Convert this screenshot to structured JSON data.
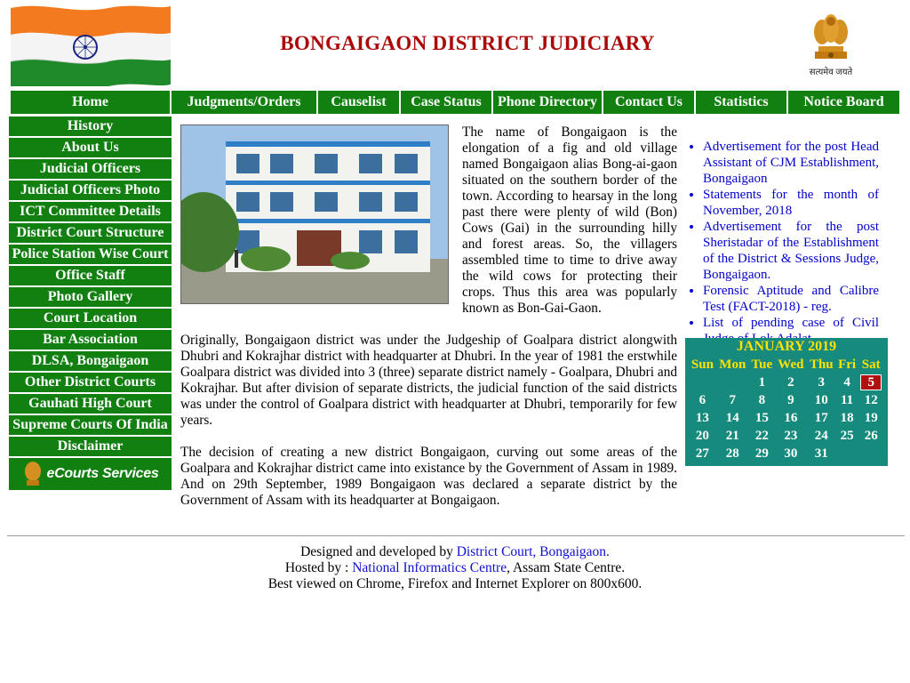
{
  "header": {
    "title": "BONGAIGAON DISTRICT JUDICIARY",
    "emblem_caption": "सत्यमेव जयते",
    "colors": {
      "title": "#aa0a0a",
      "nav": "#118011"
    }
  },
  "topnav": [
    {
      "label": "Home"
    },
    {
      "label": "Judgments/Orders"
    },
    {
      "label": "Causelist"
    },
    {
      "label": "Case Status"
    },
    {
      "label": "Phone Directory"
    },
    {
      "label": "Contact Us"
    },
    {
      "label": "Statistics"
    },
    {
      "label": "Notice Board"
    }
  ],
  "sidebar": [
    {
      "label": "History"
    },
    {
      "label": "About Us"
    },
    {
      "label": "Judicial Officers"
    },
    {
      "label": "Judicial Officers Photo"
    },
    {
      "label": "ICT Committee Details"
    },
    {
      "label": "District Court Structure"
    },
    {
      "label": "Police Station Wise Court"
    },
    {
      "label": "Office Staff"
    },
    {
      "label": "Photo Gallery"
    },
    {
      "label": "Court Location"
    },
    {
      "label": "Bar Association"
    },
    {
      "label": "DLSA, Bongaigaon"
    },
    {
      "label": "Other District Courts"
    },
    {
      "label": "Gauhati High Court"
    },
    {
      "label": "Supreme Courts Of India"
    },
    {
      "label": "Disclaimer"
    }
  ],
  "ecourts_label": "eCourts Services",
  "main": {
    "paragraphs": [
      "The name of Bongaigaon is the elongation of a fig and old village named Bongaigaon alias Bong-ai-gaon situated on the southern border of the town. According to hearsay in the long past there were plenty of wild (Bon) Cows (Gai) in the surrounding hilly and forest areas. So, the villagers assembled time to time to drive away the wild cows for protecting their crops. Thus this area was popularly known as Bon-Gai-Gaon.",
      "Originally, Bongaigaon district was under the Judgeship of Goalpara district alongwith Dhubri and Kokrajhar district with headquarter at Dhubri. In the year of 1981 the erstwhile Goalpara district was divided into 3 (three) separate district namely - Goalpara, Dhubri and Kokrajhar. But after division of separate districts, the judicial function of the said districts was under the control of Goalpara district with headquarter at Dhubri, temporarily for few years.",
      "The decision of creating a new district Bongaigaon, curving out some areas of the Goalpara and Kokrajhar district came into existance by the Government of Assam in 1989. And on 29th September, 1989 Bongaigaon was declared a separate district by the Government of Assam with its headquarter at Bongaigaon."
    ]
  },
  "notices": [
    "Advertisement for the post Head Assistant of CJM Establishment, Bongaigaon",
    "Statements for the month of November, 2018",
    "Advertisement for the post Sheristadar of the Establishment of the District & Sessions Judge, Bongaigaon.",
    "Forensic Aptitude and Calibre Test (FACT-2018) - reg.",
    "List of pending case of Civil Judge of Lok Adalat"
  ],
  "calendar": {
    "title": "JANUARY 2019",
    "weekdays": [
      "Sun",
      "Mon",
      "Tue",
      "Wed",
      "Thu",
      "Fri",
      "Sat"
    ],
    "weeks": [
      [
        "",
        "",
        "1",
        "2",
        "3",
        "4",
        "5"
      ],
      [
        "6",
        "7",
        "8",
        "9",
        "10",
        "11",
        "12"
      ],
      [
        "13",
        "14",
        "15",
        "16",
        "17",
        "18",
        "19"
      ],
      [
        "20",
        "21",
        "22",
        "23",
        "24",
        "25",
        "26"
      ],
      [
        "27",
        "28",
        "29",
        "30",
        "31",
        "",
        ""
      ]
    ],
    "today": "5"
  },
  "footer": {
    "designed_prefix": "Designed and developed by ",
    "designed_link": "District Court, Bongaigaon.",
    "hosted_prefix": "Hosted by : ",
    "hosted_link": "National Informatics Centre",
    "hosted_suffix": ", Assam State Centre.",
    "best_viewed": "Best viewed on Chrome, Firefox and Internet Explorer on 800x600."
  }
}
